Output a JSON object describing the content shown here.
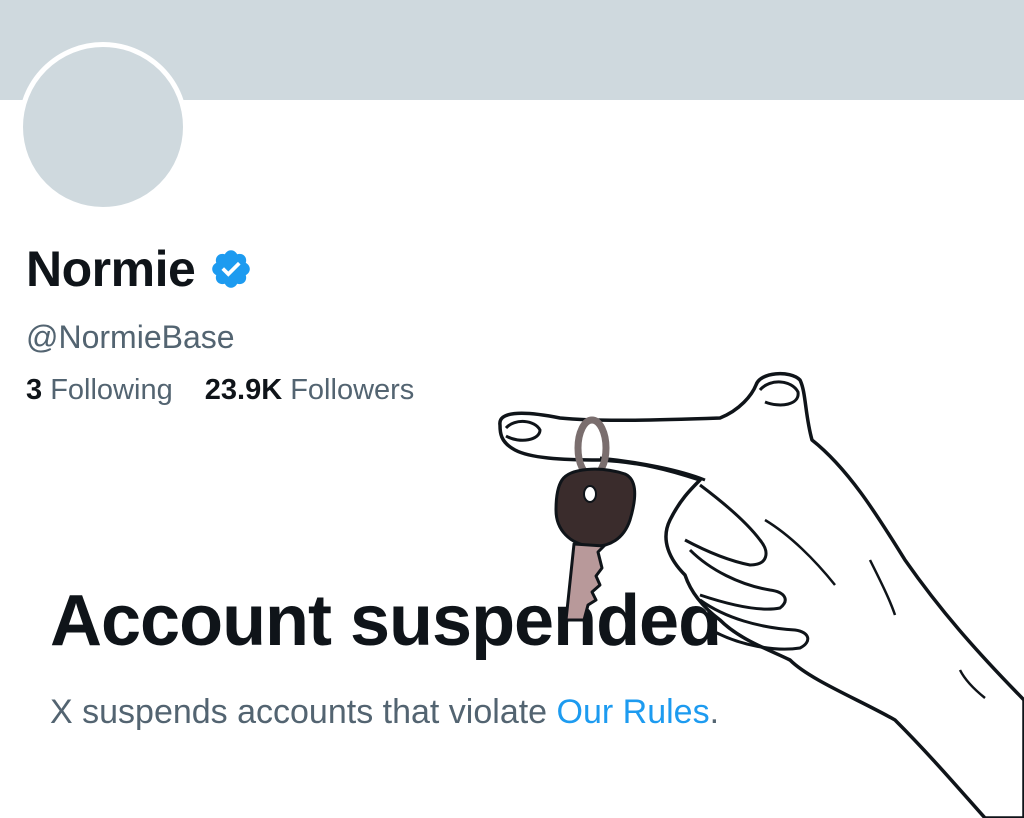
{
  "profile": {
    "display_name": "Normie",
    "handle": "@NormieBase",
    "verified_icon": "verified-badge-icon",
    "following_count": "3",
    "following_label": "Following",
    "followers_count": "23.9K",
    "followers_label": "Followers"
  },
  "suspension": {
    "title": "Account suspended",
    "description_prefix": "X suspends accounts that violate ",
    "rules_link": "Our Rules",
    "description_suffix": "."
  },
  "illustration": {
    "subject": "hand-holding-key-drawing"
  },
  "colors": {
    "banner": "#cfd9de",
    "avatar": "#cfd9de",
    "text_primary": "#0f1419",
    "text_secondary": "#536471",
    "link": "#1d9bf0",
    "verified": "#1d9bf0"
  }
}
